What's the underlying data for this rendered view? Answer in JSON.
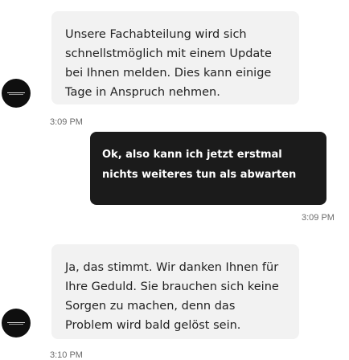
{
  "messages": [
    {
      "sender": "agent",
      "text": "Unsere Fachabteilung wird sich schnellstmöglich mit einem Update bei Ihnen melden. Dies kann einige Tage in Anspruch nehmen.",
      "time": "3:09 PM"
    },
    {
      "sender": "user",
      "text": "Ok, also kann ich jetzt erstmal nichts weiteres tun als abwarten",
      "time": "3:09 PM"
    },
    {
      "sender": "agent",
      "text": "Ja, das stimmt. Wir danken Ihnen für Ihre Geduld. Sie brauchen sich keine Sorgen zu machen, denn das Problem wird bald gelöst sein.",
      "time": "3:10 PM"
    }
  ],
  "icons": {
    "agent_avatar": "agent-avatar-icon"
  },
  "colors": {
    "agent_bubble": "#f2f2f2",
    "user_bubble": "#1b1b1b",
    "timestamp": "#6b6b6b"
  }
}
